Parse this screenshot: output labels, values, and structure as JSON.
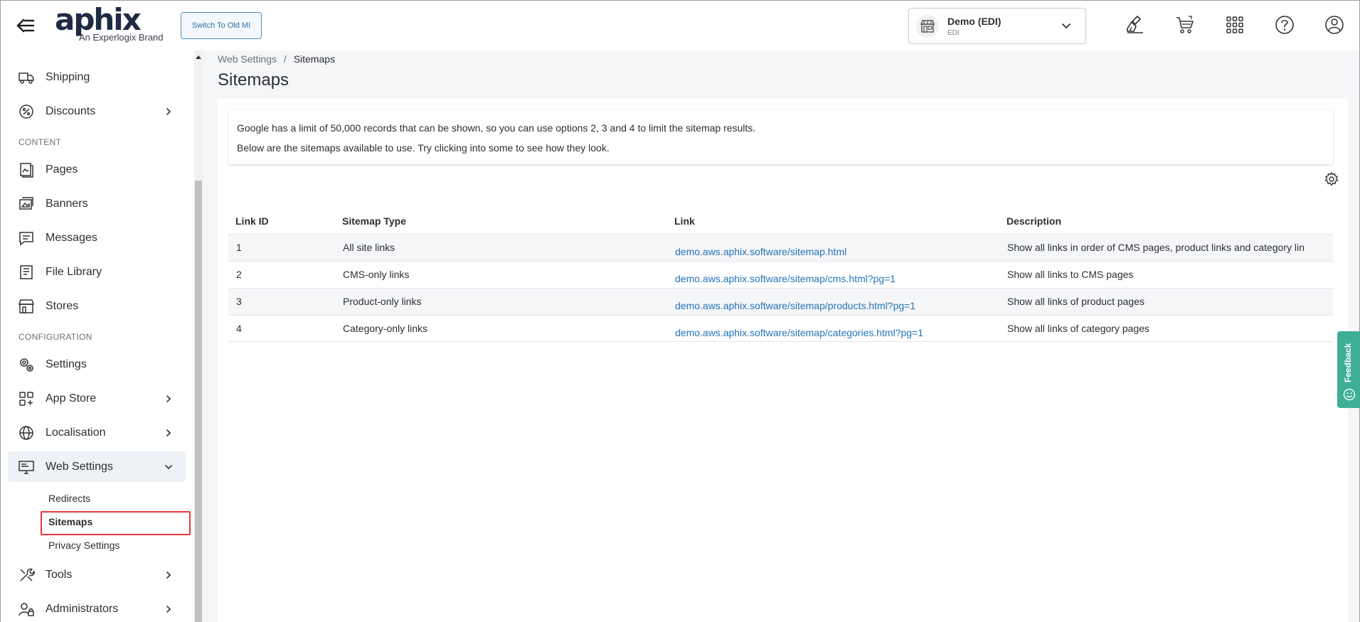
{
  "header": {
    "logo_text": "aphix",
    "logo_tagline": "An Experlogix Brand",
    "switch_button": "Switch To Old MI",
    "store": {
      "name": "Demo (EDI)",
      "subtitle": "EDI"
    }
  },
  "sidebar": {
    "items": [
      {
        "label": "Shipping",
        "icon": "truck-icon",
        "has_chevron": false
      },
      {
        "label": "Discounts",
        "icon": "discount-icon",
        "has_chevron": true
      },
      {
        "label": "Pages",
        "icon": "pages-icon",
        "has_chevron": false
      },
      {
        "label": "Banners",
        "icon": "banner-icon",
        "has_chevron": false
      },
      {
        "label": "Messages",
        "icon": "message-icon",
        "has_chevron": false
      },
      {
        "label": "File Library",
        "icon": "file-library-icon",
        "has_chevron": false
      },
      {
        "label": "Stores",
        "icon": "store-icon",
        "has_chevron": false
      },
      {
        "label": "Settings",
        "icon": "gears-icon",
        "has_chevron": false
      },
      {
        "label": "App Store",
        "icon": "app-store-icon",
        "has_chevron": true
      },
      {
        "label": "Localisation",
        "icon": "globe-icon",
        "has_chevron": true
      },
      {
        "label": "Web Settings",
        "icon": "monitor-icon",
        "has_chevron": true
      },
      {
        "label": "Tools",
        "icon": "tools-icon",
        "has_chevron": true
      },
      {
        "label": "Administrators",
        "icon": "admin-icon",
        "has_chevron": true
      }
    ],
    "sections": {
      "content": "CONTENT",
      "configuration": "CONFIGURATION"
    },
    "web_settings_sub": [
      "Redirects",
      "Sitemaps",
      "Privacy Settings"
    ]
  },
  "breadcrumb": {
    "parent": "Web Settings",
    "separator": "/",
    "current": "Sitemaps"
  },
  "page_title": "Sitemaps",
  "info": {
    "line1": "Google has a limit of 50,000 records that can be shown, so you can use options 2, 3 and 4 to limit the sitemap results.",
    "line2": "Below are the sitemaps available to use. Try clicking into some to see how they look."
  },
  "table": {
    "headers": [
      "Link ID",
      "Sitemap Type",
      "Link",
      "Description"
    ],
    "rows": [
      {
        "id": "1",
        "type": "All site links",
        "link": "demo.aws.aphix.software/sitemap.html",
        "description": "Show all links in order of CMS pages, product links and category lin"
      },
      {
        "id": "2",
        "type": "CMS-only links",
        "link": "demo.aws.aphix.software/sitemap/cms.html?pg=1",
        "description": "Show all links to CMS pages"
      },
      {
        "id": "3",
        "type": "Product-only links",
        "link": "demo.aws.aphix.software/sitemap/products.html?pg=1",
        "description": "Show all links of product pages"
      },
      {
        "id": "4",
        "type": "Category-only links",
        "link": "demo.aws.aphix.software/sitemap/categories.html?pg=1",
        "description": "Show all links of category pages"
      }
    ]
  },
  "feedback_label": "Feedback",
  "colors": {
    "link": "#2574b8",
    "highlight": "#e0393e",
    "feedback": "#3fae97"
  }
}
